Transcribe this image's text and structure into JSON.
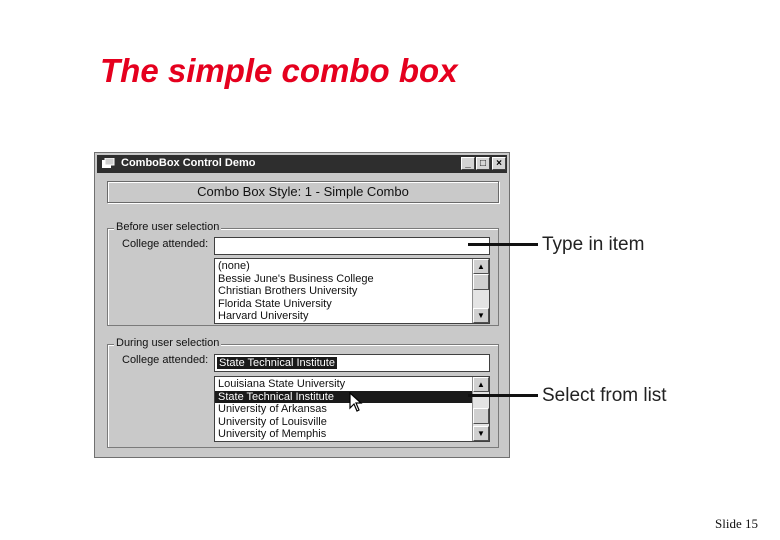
{
  "slide": {
    "title": "The simple combo box",
    "number": "Slide 15"
  },
  "window": {
    "title": "ComboBox Control Demo",
    "buttons": {
      "minimize": "_",
      "maximize": "□",
      "close": "×"
    },
    "style_banner": "Combo Box Style: 1 - Simple Combo"
  },
  "before": {
    "group_label": "Before user selection",
    "field_label": "College attended:",
    "input_value": "",
    "items": [
      "(none)",
      "Bessie June's Business College",
      "Christian Brothers University",
      "Florida State University",
      "Harvard University"
    ]
  },
  "during": {
    "group_label": "During user selection",
    "field_label": "College attended:",
    "input_value": "State Technical Institute",
    "items": [
      "Louisiana State University",
      "State Technical Institute",
      "University of Arkansas",
      "University of Louisville",
      "University of Memphis"
    ],
    "selected_index": 1
  },
  "callouts": {
    "type_in": "Type in item",
    "select_from": "Select from list"
  },
  "icons": {
    "app": "app-window-icon",
    "scroll_up": "arrow-up-icon",
    "scroll_down": "arrow-down-icon",
    "cursor": "mouse-pointer-icon"
  },
  "colors": {
    "title_red": "#e5001e",
    "titlebar": "#2e2e2e",
    "window_face": "#c9c9c9",
    "selection": "#1a1a1a"
  }
}
